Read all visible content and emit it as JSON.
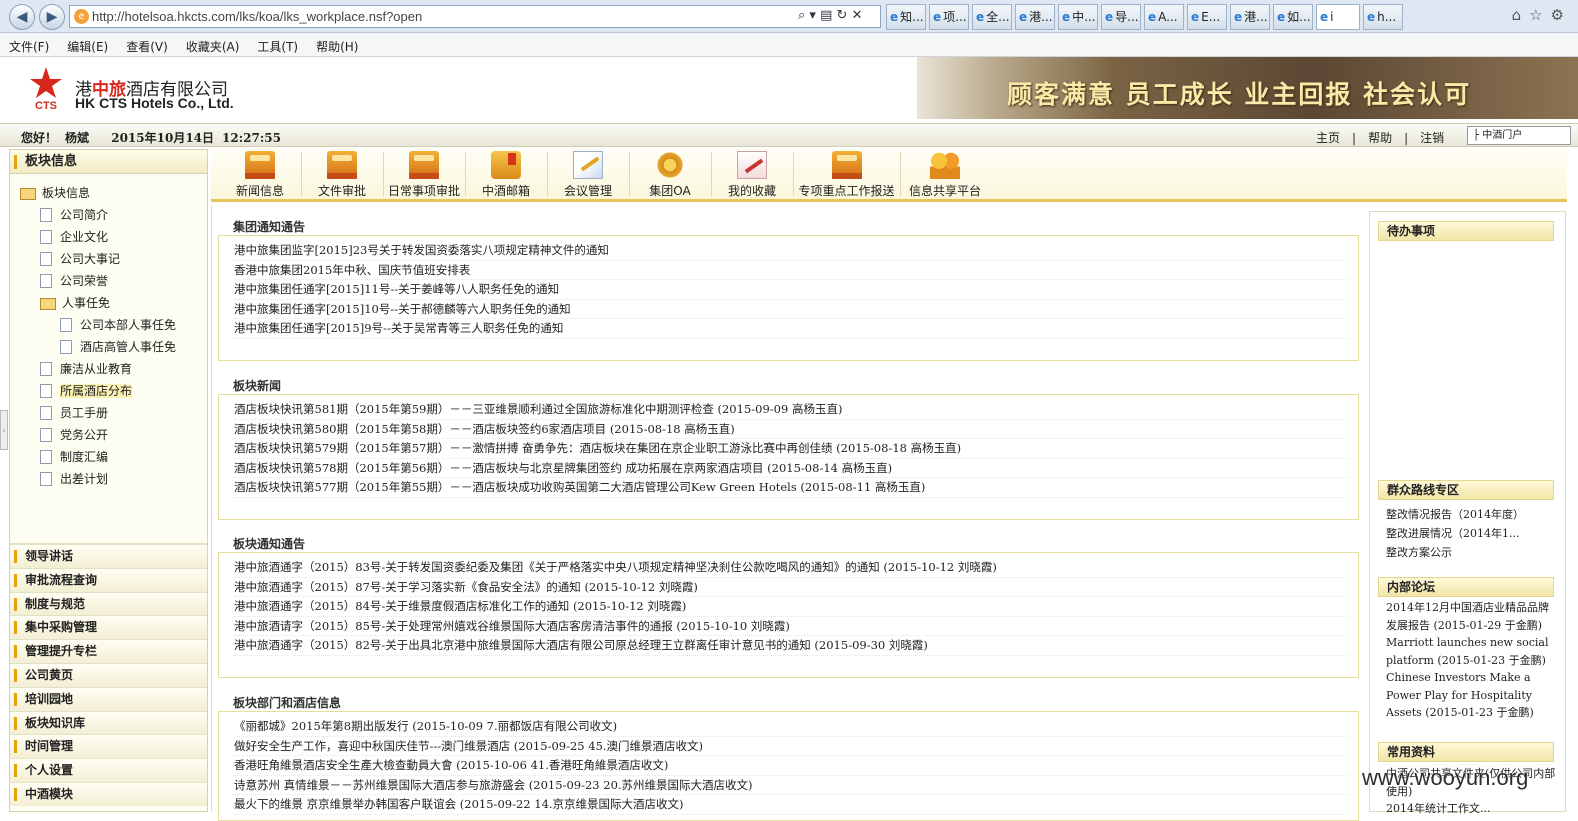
{
  "browser": {
    "url": "http://hotelsoa.hkcts.com/lks/koa/lks_workplace.nsf?open",
    "tabs": [
      "知...",
      "项...",
      "全...",
      "港...",
      "中...",
      "导...",
      "A...",
      "E...",
      "港...",
      "如...",
      "i",
      "h..."
    ],
    "menu": [
      "文件(F)",
      "编辑(E)",
      "查看(V)",
      "收藏夹(A)",
      "工具(T)",
      "帮助(H)"
    ]
  },
  "header": {
    "logo_abbr": "CTS",
    "company_cn_prefix": "港",
    "company_cn_brand": "中旅",
    "company_cn_suffix": "酒店有限公司",
    "company_en": "HK CTS Hotels Co., Ltd.",
    "slogan": "顾客满意  员工成长  业主回报  社会认可"
  },
  "infobar": {
    "greeting": "您好！",
    "user": "杨斌",
    "date": "2015年10月14日",
    "time": "12:27:55",
    "links": [
      "主页",
      "帮助",
      "注销"
    ],
    "portal_select": "├ 中酒门户"
  },
  "sidebar": {
    "title": "板块信息",
    "tree": [
      {
        "label": "板块信息",
        "level": 0,
        "icon": "folder-open-icon"
      },
      {
        "label": "公司简介",
        "level": 1,
        "icon": "page-icon"
      },
      {
        "label": "企业文化",
        "level": 1,
        "icon": "page-icon"
      },
      {
        "label": "公司大事记",
        "level": 1,
        "icon": "page-icon"
      },
      {
        "label": "公司荣誉",
        "level": 1,
        "icon": "page-icon"
      },
      {
        "label": "人事任免",
        "level": 1,
        "icon": "folder-open-icon"
      },
      {
        "label": "公司本部人事任免",
        "level": 2,
        "icon": "page-icon"
      },
      {
        "label": "酒店高管人事任免",
        "level": 2,
        "icon": "page-icon"
      },
      {
        "label": "廉洁从业教育",
        "level": 1,
        "icon": "page-icon"
      },
      {
        "label": "所属酒店分布",
        "level": 1,
        "icon": "page-icon",
        "highlight": true
      },
      {
        "label": "员工手册",
        "level": 1,
        "icon": "page-icon"
      },
      {
        "label": "党务公开",
        "level": 1,
        "icon": "page-icon"
      },
      {
        "label": "制度汇编",
        "level": 1,
        "icon": "page-icon"
      },
      {
        "label": "出差计划",
        "level": 1,
        "icon": "page-icon"
      }
    ],
    "modules": [
      "领导讲话",
      "审批流程查询",
      "制度与规范",
      "集中采购管理",
      "管理提升专栏",
      "公司黄页",
      "培训园地",
      "板块知识库",
      "时间管理",
      "个人设置",
      "中酒模块"
    ]
  },
  "toolbar": [
    {
      "label": "新闻信息",
      "icon": "news-book-icon"
    },
    {
      "label": "文件审批",
      "icon": "file-approval-icon"
    },
    {
      "label": "日常事项审批",
      "icon": "daily-approval-icon"
    },
    {
      "label": "中酒邮箱",
      "icon": "mailbox-icon"
    },
    {
      "label": "会议管理",
      "icon": "meeting-icon"
    },
    {
      "label": "集团OA",
      "icon": "gear-icon"
    },
    {
      "label": "我的收藏",
      "icon": "favorites-icon"
    },
    {
      "label": "专项重点工作报送",
      "icon": "report-book-icon"
    },
    {
      "label": "信息共享平台",
      "icon": "people-icon"
    }
  ],
  "sections": [
    {
      "title": "集团通知通告",
      "items": [
        "港中旅集团监字[2015]23号关于转发国资委落实八项规定精神文件的通知",
        "香港中旅集团2015年中秋、国庆节值班安排表",
        "港中旅集团任通字[2015]11号--关于姜峰等八人职务任免的通知",
        "港中旅集团任通字[2015]10号--关于郝德麟等六人职务任免的通知",
        "港中旅集团任通字[2015]9号--关于吴常青等三人职务任免的通知"
      ]
    },
    {
      "title": "板块新闻",
      "items": [
        "酒店板块快讯第581期（2015年第59期）－－三亚维景顺利通过全国旅游标准化中期测评检查 (2015-09-09 高杨玉直)",
        "酒店板块快讯第580期（2015年第58期）－－酒店板块签约6家酒店项目 (2015-08-18 高杨玉直)",
        "酒店板块快讯第579期（2015年第57期）－－激情拼搏 奋勇争先：酒店板块在集团在京企业职工游泳比赛中再创佳绩 (2015-08-18 高杨玉直)",
        "酒店板块快讯第578期（2015年第56期）－－酒店板块与北京星牌集团签约 成功拓展在京两家酒店项目 (2015-08-14 高杨玉直)",
        "酒店板块快讯第577期（2015年第55期）－－酒店板块成功收购英国第二大酒店管理公司Kew Green Hotels (2015-08-11 高杨玉直)"
      ]
    },
    {
      "title": "板块通知通告",
      "items": [
        "港中旅酒通字（2015）83号-关于转发国资委纪委及集团《关于严格落实中央八项规定精神坚决刹住公款吃喝风的通知》的通知 (2015-10-12 刘晓霞)",
        "港中旅酒通字（2015）87号-关于学习落实新《食品安全法》的通知 (2015-10-12 刘晓霞)",
        "港中旅酒通字（2015）84号-关于维景度假酒店标准化工作的通知 (2015-10-12 刘晓霞)",
        "港中旅酒请字（2015）85号-关于处理常州嬉戏谷维景国际大酒店客房清洁事件的通报 (2015-10-10 刘晓霞)",
        "港中旅酒通字（2015）82号-关于出具北京港中旅维景国际大酒店有限公司原总经理王立群离任审计意见书的通知 (2015-09-30 刘晓霞)"
      ]
    },
    {
      "title": "板块部门和酒店信息",
      "items": [
        "《丽都城》2015年第8期出版发行 (2015-10-09 7.丽都饭店有限公司收文)",
        "做好安全生产工作，喜迎中秋国庆佳节---澳门维景酒店 (2015-09-25 45.澳门维景酒店收文)",
        "香港旺角維景酒店安全生產大檢查動員大會 (2015-10-06 41.香港旺角維景酒店收文)",
        "诗意苏州 真情维景－－苏州维景国际大酒店参与旅游盛会 (2015-09-23 20.苏州维景国际大酒店收文)",
        "最火下的维景 京京维景举办韩国客户联谊会 (2015-09-22 14.京京维景国际大酒店收文)"
      ]
    }
  ],
  "right": {
    "todo_title": "待办事项",
    "mass_line_title": "群众路线专区",
    "mass_line_items": [
      "整改情况报告（2014年度）",
      "整改进展情况（2014年1...",
      "整改方案公示"
    ],
    "forum_title": "内部论坛",
    "forum_items": [
      "2014年12月中国酒店业精品品牌发展报告 (2015-01-29 于金鹏)",
      "Marriott launches new social platform (2015-01-23 于金鹏)",
      "Chinese Investors Make a Power Play for Hospitality Assets (2015-01-23 于金鹏)"
    ],
    "resources_title": "常用资料",
    "resources_items": [
      "中酒公司共享文件夹(仅供公司内部使用)",
      "2014年统计工作文..."
    ]
  },
  "watermark": "www.wooyun.org",
  "colors": {
    "accent": "#e5a20a",
    "brand_red": "#d8281d",
    "toolbar_border": "#e8c558"
  }
}
